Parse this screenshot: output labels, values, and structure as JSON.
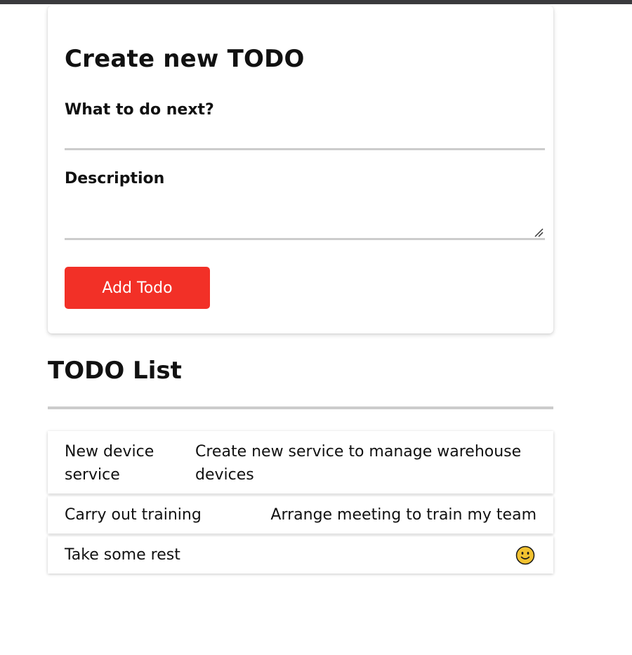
{
  "form": {
    "title": "Create new TODO",
    "next_label": "What to do next?",
    "next_value": "",
    "description_label": "Description",
    "description_value": "",
    "submit_label": "Add Todo"
  },
  "list": {
    "title": "TODO List",
    "items": [
      {
        "name": "New device service",
        "description": "Create new service to manage warehouse devices"
      },
      {
        "name": "Carry out training",
        "description": "Arrange meeting to train my team"
      },
      {
        "name": "Take some rest",
        "description": "",
        "icon": "smiley-face-icon"
      }
    ]
  },
  "colors": {
    "accent": "#f23027",
    "divider": "#cccccc",
    "topbar": "#3a3a3d",
    "smiley": "#f2c230"
  }
}
